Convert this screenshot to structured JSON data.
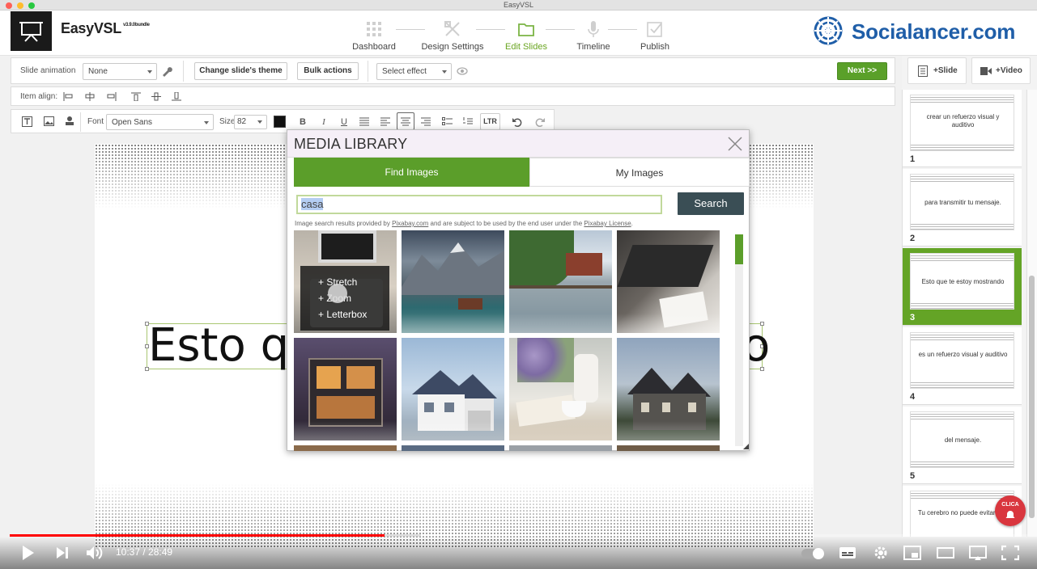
{
  "window": {
    "title": "EasyVSL"
  },
  "header": {
    "brand": "EasyVSL",
    "version": "v3.9.0bundle",
    "steps": [
      {
        "label": "Dashboard",
        "icon": "grid-icon"
      },
      {
        "label": "Design Settings",
        "icon": "design-tools-icon"
      },
      {
        "label": "Edit Slides",
        "icon": "folder-icon",
        "active": true
      },
      {
        "label": "Timeline",
        "icon": "microphone-icon"
      },
      {
        "label": "Publish",
        "icon": "checkbox-icon"
      }
    ],
    "watermark": "Socialancer.com"
  },
  "toolbar1": {
    "slide_animation_label": "Slide animation",
    "slide_animation_value": "None",
    "change_theme": "Change slide's theme",
    "bulk_actions": "Bulk actions",
    "effect_value": "Select effect",
    "next": "Next  >>"
  },
  "toolbar2": {
    "item_align_label": "Item align:"
  },
  "toolbar3": {
    "font_label": "Font",
    "font_value": "Open Sans",
    "size_label": "Size",
    "size_value": "82",
    "bold": "B",
    "italic": "I",
    "underline": "U",
    "ltr": "LTR"
  },
  "sidebar_buttons": {
    "add_slide": "+Slide",
    "add_video": "+Video"
  },
  "canvas": {
    "text_left": "Esto qu",
    "text_right": "o"
  },
  "media_library": {
    "title": "MEDIA LIBRARY",
    "tab_find": "Find Images",
    "tab_my": "My Images",
    "search_value": "casa",
    "search_button": "Search",
    "credit_prefix": "Image search results provided by ",
    "credit_site": "Pixabay.com",
    "credit_middle": " and are subject to be used by the end user under the ",
    "credit_license": "Pixabay License",
    "credit_suffix": ".",
    "hover_options": [
      "+ Stretch",
      "+ Zoom",
      "+ Letterbox"
    ]
  },
  "slides": [
    {
      "num": "1",
      "text": "crear un refuerzo visual y auditivo"
    },
    {
      "num": "2",
      "text": "para transmitir tu mensaje."
    },
    {
      "num": "3",
      "text": "Esto que te estoy mostrando",
      "active": true
    },
    {
      "num": "4",
      "text": "es un refuerzo visual y auditivo"
    },
    {
      "num": "5",
      "text": "del mensaje."
    },
    {
      "num": "6",
      "text": "Tu cerebro no puede evitar leer"
    }
  ],
  "player": {
    "current_time": "10:37",
    "duration": "28:49",
    "time_display": "10:37 / 28:49",
    "progress_fraction": 0.368,
    "clica_badge": "CLICA"
  },
  "colors": {
    "accent": "#64a426",
    "brand_blue": "#1f5ea8",
    "progress_red": "#ff0000"
  }
}
